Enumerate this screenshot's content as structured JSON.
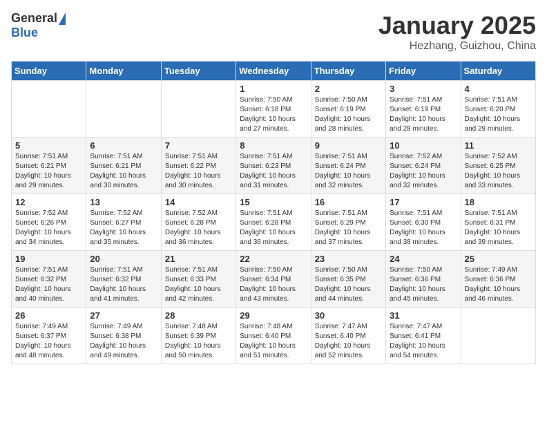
{
  "header": {
    "logo_general": "General",
    "logo_blue": "Blue",
    "month": "January 2025",
    "location": "Hezhang, Guizhou, China"
  },
  "days_of_week": [
    "Sunday",
    "Monday",
    "Tuesday",
    "Wednesday",
    "Thursday",
    "Friday",
    "Saturday"
  ],
  "weeks": [
    [
      {
        "day": "",
        "info": ""
      },
      {
        "day": "",
        "info": ""
      },
      {
        "day": "",
        "info": ""
      },
      {
        "day": "1",
        "info": "Sunrise: 7:50 AM\nSunset: 6:18 PM\nDaylight: 10 hours\nand 27 minutes."
      },
      {
        "day": "2",
        "info": "Sunrise: 7:50 AM\nSunset: 6:19 PM\nDaylight: 10 hours\nand 28 minutes."
      },
      {
        "day": "3",
        "info": "Sunrise: 7:51 AM\nSunset: 6:19 PM\nDaylight: 10 hours\nand 28 minutes."
      },
      {
        "day": "4",
        "info": "Sunrise: 7:51 AM\nSunset: 6:20 PM\nDaylight: 10 hours\nand 29 minutes."
      }
    ],
    [
      {
        "day": "5",
        "info": "Sunrise: 7:51 AM\nSunset: 6:21 PM\nDaylight: 10 hours\nand 29 minutes."
      },
      {
        "day": "6",
        "info": "Sunrise: 7:51 AM\nSunset: 6:21 PM\nDaylight: 10 hours\nand 30 minutes."
      },
      {
        "day": "7",
        "info": "Sunrise: 7:51 AM\nSunset: 6:22 PM\nDaylight: 10 hours\nand 30 minutes."
      },
      {
        "day": "8",
        "info": "Sunrise: 7:51 AM\nSunset: 6:23 PM\nDaylight: 10 hours\nand 31 minutes."
      },
      {
        "day": "9",
        "info": "Sunrise: 7:51 AM\nSunset: 6:24 PM\nDaylight: 10 hours\nand 32 minutes."
      },
      {
        "day": "10",
        "info": "Sunrise: 7:52 AM\nSunset: 6:24 PM\nDaylight: 10 hours\nand 32 minutes."
      },
      {
        "day": "11",
        "info": "Sunrise: 7:52 AM\nSunset: 6:25 PM\nDaylight: 10 hours\nand 33 minutes."
      }
    ],
    [
      {
        "day": "12",
        "info": "Sunrise: 7:52 AM\nSunset: 6:26 PM\nDaylight: 10 hours\nand 34 minutes."
      },
      {
        "day": "13",
        "info": "Sunrise: 7:52 AM\nSunset: 6:27 PM\nDaylight: 10 hours\nand 35 minutes."
      },
      {
        "day": "14",
        "info": "Sunrise: 7:52 AM\nSunset: 6:28 PM\nDaylight: 10 hours\nand 36 minutes."
      },
      {
        "day": "15",
        "info": "Sunrise: 7:51 AM\nSunset: 6:28 PM\nDaylight: 10 hours\nand 36 minutes."
      },
      {
        "day": "16",
        "info": "Sunrise: 7:51 AM\nSunset: 6:29 PM\nDaylight: 10 hours\nand 37 minutes."
      },
      {
        "day": "17",
        "info": "Sunrise: 7:51 AM\nSunset: 6:30 PM\nDaylight: 10 hours\nand 38 minutes."
      },
      {
        "day": "18",
        "info": "Sunrise: 7:51 AM\nSunset: 6:31 PM\nDaylight: 10 hours\nand 39 minutes."
      }
    ],
    [
      {
        "day": "19",
        "info": "Sunrise: 7:51 AM\nSunset: 6:32 PM\nDaylight: 10 hours\nand 40 minutes."
      },
      {
        "day": "20",
        "info": "Sunrise: 7:51 AM\nSunset: 6:32 PM\nDaylight: 10 hours\nand 41 minutes."
      },
      {
        "day": "21",
        "info": "Sunrise: 7:51 AM\nSunset: 6:33 PM\nDaylight: 10 hours\nand 42 minutes."
      },
      {
        "day": "22",
        "info": "Sunrise: 7:50 AM\nSunset: 6:34 PM\nDaylight: 10 hours\nand 43 minutes."
      },
      {
        "day": "23",
        "info": "Sunrise: 7:50 AM\nSunset: 6:35 PM\nDaylight: 10 hours\nand 44 minutes."
      },
      {
        "day": "24",
        "info": "Sunrise: 7:50 AM\nSunset: 6:36 PM\nDaylight: 10 hours\nand 45 minutes."
      },
      {
        "day": "25",
        "info": "Sunrise: 7:49 AM\nSunset: 6:36 PM\nDaylight: 10 hours\nand 46 minutes."
      }
    ],
    [
      {
        "day": "26",
        "info": "Sunrise: 7:49 AM\nSunset: 6:37 PM\nDaylight: 10 hours\nand 48 minutes."
      },
      {
        "day": "27",
        "info": "Sunrise: 7:49 AM\nSunset: 6:38 PM\nDaylight: 10 hours\nand 49 minutes."
      },
      {
        "day": "28",
        "info": "Sunrise: 7:48 AM\nSunset: 6:39 PM\nDaylight: 10 hours\nand 50 minutes."
      },
      {
        "day": "29",
        "info": "Sunrise: 7:48 AM\nSunset: 6:40 PM\nDaylight: 10 hours\nand 51 minutes."
      },
      {
        "day": "30",
        "info": "Sunrise: 7:47 AM\nSunset: 6:40 PM\nDaylight: 10 hours\nand 52 minutes."
      },
      {
        "day": "31",
        "info": "Sunrise: 7:47 AM\nSunset: 6:41 PM\nDaylight: 10 hours\nand 54 minutes."
      },
      {
        "day": "",
        "info": ""
      }
    ]
  ]
}
